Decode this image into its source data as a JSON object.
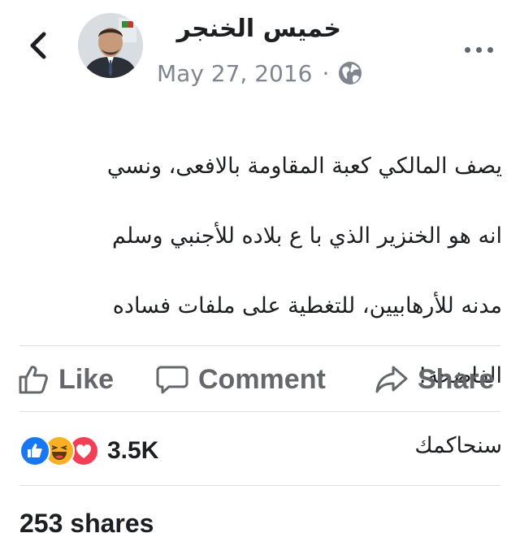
{
  "post": {
    "author": "خميس الخنجر",
    "date": "May 27, 2016",
    "separator": "·",
    "privacy_icon": "globe-icon",
    "text_lines": [
      "يصف المالكي كعبة المقاومة بالافعى، ونسي",
      "انه هو الخنزير الذي با ع بلاده للأجنبي وسلم",
      "مدنه للأرهابيين، للتغطية على ملفات فساده",
      "الفاضحة!",
      "سنحاكمك"
    ]
  },
  "actions": {
    "like_label": "Like",
    "comment_label": "Comment",
    "share_label": "Share"
  },
  "reactions": {
    "icons": [
      "like-reaction-icon",
      "haha-reaction-icon",
      "love-reaction-icon"
    ],
    "count": "3.5K"
  },
  "shares_text": "253 shares",
  "colors": {
    "like_blue": "#1877f2",
    "haha_yellow": "#f7b125",
    "love_red": "#f33e58",
    "secondary_text": "#65676b"
  }
}
